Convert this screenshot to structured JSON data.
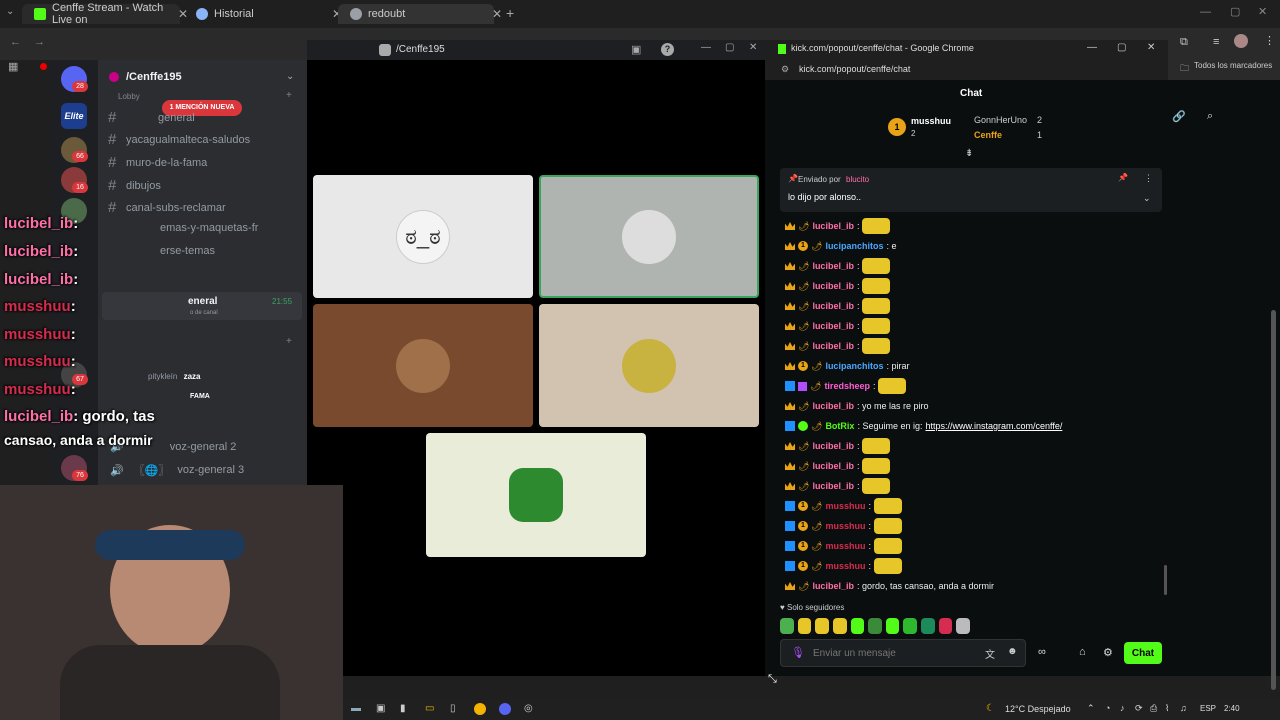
{
  "browser_tabs": [
    {
      "label": "Cenffe Stream - Watch Live on",
      "color": "#53fc18"
    },
    {
      "label": "Historial",
      "color": "#8ab4f8"
    },
    {
      "label": "redoubt",
      "color": "#9aa0a6"
    }
  ],
  "discord": {
    "server_name": "/Cenffe195",
    "mention_badge": "1 MENCIÓN NUEVA",
    "category": "Lobby",
    "channels": [
      "general",
      "yacagualmalteca-saludos",
      "muro-de-la-fama",
      "dibujos",
      "canal-subs-reclamar",
      "emas-y-maquetas-fr",
      "erse-temas"
    ],
    "voice_channel": "eneral",
    "voice_time": "21:55",
    "voice_sub": "o de canal",
    "voice_users": [
      {
        "name": "pitykleín",
        "tag": "zaza"
      },
      {
        "name": "",
        "tag": "FAMA"
      }
    ],
    "voice_extra": [
      "voz-general 2",
      "voz-general 3"
    ],
    "guild_badges": [
      "28",
      "66",
      "16",
      "67",
      "76"
    ]
  },
  "overlay_chat": [
    {
      "user": "lucibel_ib",
      "text": ":"
    },
    {
      "user": "lucibel_ib",
      "text": ":"
    },
    {
      "user": "lucibel_ib",
      "text": ":"
    },
    {
      "user": "musshuu",
      "text": ":"
    },
    {
      "user": "musshuu",
      "text": ":"
    },
    {
      "user": "musshuu",
      "text": ":"
    },
    {
      "user": "musshuu",
      "text": ":"
    },
    {
      "user": "lucibel_ib",
      "text": ": gordo, tas"
    },
    {
      "user": "",
      "text": "cansao, anda a dormir"
    }
  ],
  "call": {
    "title": "/Cenffe195"
  },
  "chat_window": {
    "chrome_title": "kick.com/popout/cenffe/chat - Google Chrome",
    "url": "kick.com/popout/cenffe/chat",
    "bookmarks": "Todos los marcadores",
    "header": "Chat",
    "leaders": [
      {
        "name": "musshuu",
        "count": "2"
      },
      {
        "name": "GonnHerUno",
        "count": "2"
      },
      {
        "name": "Cenffe",
        "count": "1"
      }
    ],
    "pinned_by_label": "Enviado por",
    "pinned_by": "blucito",
    "pinned_text": "lo dijo por alonso..",
    "messages": [
      {
        "user": "lucibel_ib",
        "color": "#ff6fa8",
        "text": ":"
      },
      {
        "user": "lucipanchitos",
        "color": "#4aa8ff",
        "text": ": e"
      },
      {
        "user": "lucibel_ib",
        "color": "#ff6fa8",
        "text": ":"
      },
      {
        "user": "lucibel_ib",
        "color": "#ff6fa8",
        "text": ":"
      },
      {
        "user": "lucibel_ib",
        "color": "#ff6fa8",
        "text": ":"
      },
      {
        "user": "lucibel_ib",
        "color": "#ff6fa8",
        "text": ":"
      },
      {
        "user": "lucibel_ib",
        "color": "#ff6fa8",
        "text": ":"
      },
      {
        "user": "lucipanchitos",
        "color": "#4aa8ff",
        "text": ": pirar"
      },
      {
        "user": "tiredsheep",
        "color": "#ff5fd0",
        "text": ":"
      },
      {
        "user": "lucibel_ib",
        "color": "#ff6fa8",
        "text": ": yo me las re piro"
      },
      {
        "user": "BotRix",
        "color": "#53fc18",
        "text": ": Seguime en ig:",
        "link": "https://www.instagram.com/cenffe/"
      },
      {
        "user": "lucibel_ib",
        "color": "#ff6fa8",
        "text": ":"
      },
      {
        "user": "lucibel_ib",
        "color": "#ff6fa8",
        "text": ":"
      },
      {
        "user": "lucibel_ib",
        "color": "#ff6fa8",
        "text": ":"
      },
      {
        "user": "musshuu",
        "color": "#d62c4f",
        "text": ":"
      },
      {
        "user": "musshuu",
        "color": "#d62c4f",
        "text": ":"
      },
      {
        "user": "musshuu",
        "color": "#d62c4f",
        "text": ":"
      },
      {
        "user": "musshuu",
        "color": "#d62c4f",
        "text": ":"
      },
      {
        "user": "lucibel_ib",
        "color": "#ff6fa8",
        "text": ": gordo, tas cansao, anda a dormir"
      }
    ],
    "followers_only": "Solo seguidores",
    "input_placeholder": "Enviar un mensaje",
    "send_label": "Chat"
  },
  "taskbar": {
    "weather": "12°C Despejado",
    "lang": "ESP",
    "time": "2:40"
  }
}
